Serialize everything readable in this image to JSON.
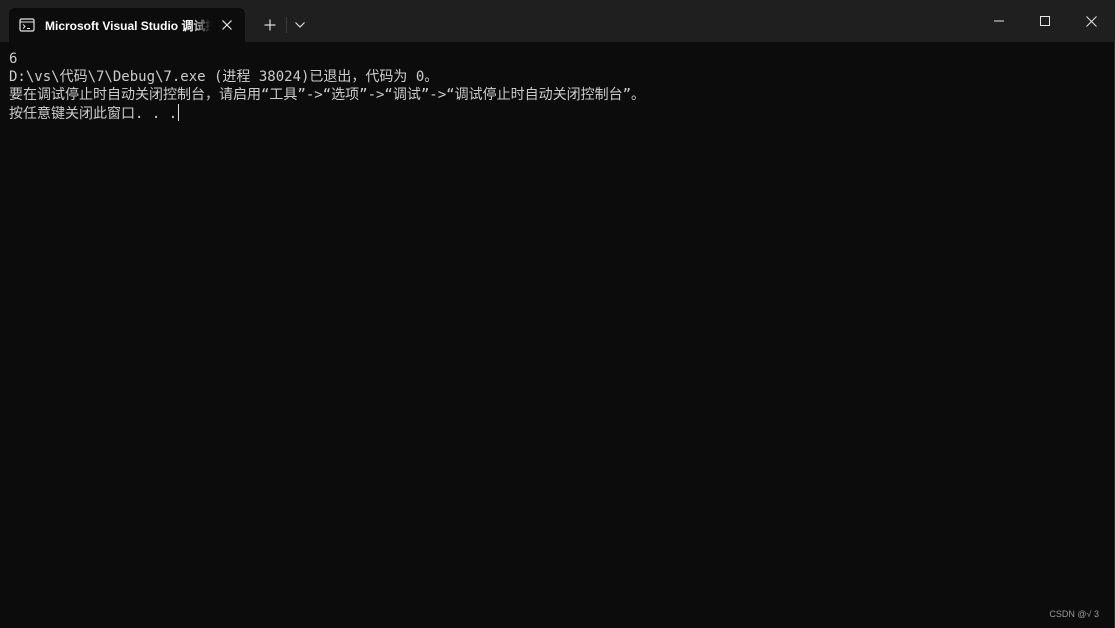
{
  "window": {
    "tab_title": "Microsoft Visual Studio 调试控制台",
    "new_tab_symbol": "+",
    "icons": {
      "tab": "console-icon",
      "close_tab": "close-icon",
      "new_tab": "plus-icon",
      "dropdown": "chevron-down-icon",
      "minimize": "minimize-icon",
      "maximize": "maximize-icon",
      "close_window": "close-icon"
    },
    "colors": {
      "titlebar": "#1f1f1f",
      "console_background": "#0c0c0c",
      "console_text": "#cccccc"
    }
  },
  "console": {
    "lines": [
      "6",
      "D:\\vs\\代码\\7\\Debug\\7.exe (进程 38024)已退出，代码为 0。",
      "要在调试停止时自动关闭控制台，请启用“工具”->“选项”->“调试”->“调试停止时自动关闭控制台”。",
      "按任意键关闭此窗口. . ."
    ]
  },
  "watermark": "CSDN @√ 3"
}
